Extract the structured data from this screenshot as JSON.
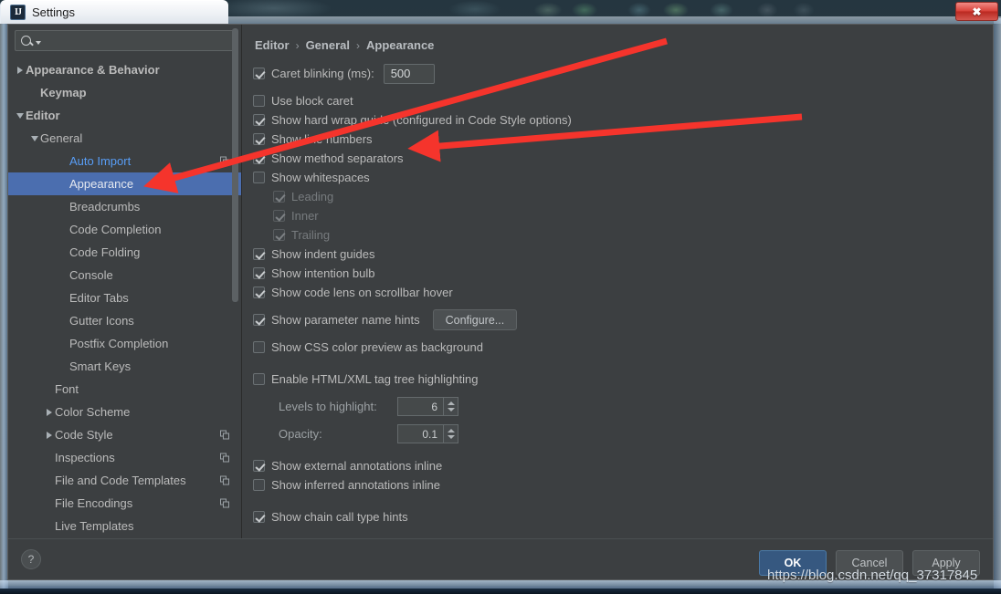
{
  "window": {
    "title": "Settings",
    "app_icon": "intellij-idea-logo",
    "close_label": "✖"
  },
  "sidebar": {
    "search": {
      "value": "",
      "placeholder": "",
      "icon": "search-icon"
    },
    "items": [
      {
        "label": "Appearance & Behavior",
        "indent": 0,
        "arrow": "right",
        "bold": true,
        "selected": false,
        "modified": false,
        "copy": false
      },
      {
        "label": "Keymap",
        "indent": 1,
        "arrow": "none",
        "bold": true,
        "selected": false,
        "modified": false,
        "copy": false
      },
      {
        "label": "Editor",
        "indent": 0,
        "arrow": "down",
        "bold": true,
        "selected": false,
        "modified": false,
        "copy": false
      },
      {
        "label": "General",
        "indent": 1,
        "arrow": "down",
        "bold": false,
        "selected": false,
        "modified": false,
        "copy": false
      },
      {
        "label": "Auto Import",
        "indent": 3,
        "arrow": "none",
        "bold": false,
        "selected": false,
        "modified": true,
        "copy": true
      },
      {
        "label": "Appearance",
        "indent": 3,
        "arrow": "none",
        "bold": false,
        "selected": true,
        "modified": false,
        "copy": false
      },
      {
        "label": "Breadcrumbs",
        "indent": 3,
        "arrow": "none",
        "bold": false,
        "selected": false,
        "modified": false,
        "copy": false
      },
      {
        "label": "Code Completion",
        "indent": 3,
        "arrow": "none",
        "bold": false,
        "selected": false,
        "modified": false,
        "copy": false
      },
      {
        "label": "Code Folding",
        "indent": 3,
        "arrow": "none",
        "bold": false,
        "selected": false,
        "modified": false,
        "copy": false
      },
      {
        "label": "Console",
        "indent": 3,
        "arrow": "none",
        "bold": false,
        "selected": false,
        "modified": false,
        "copy": false
      },
      {
        "label": "Editor Tabs",
        "indent": 3,
        "arrow": "none",
        "bold": false,
        "selected": false,
        "modified": false,
        "copy": false
      },
      {
        "label": "Gutter Icons",
        "indent": 3,
        "arrow": "none",
        "bold": false,
        "selected": false,
        "modified": false,
        "copy": false
      },
      {
        "label": "Postfix Completion",
        "indent": 3,
        "arrow": "none",
        "bold": false,
        "selected": false,
        "modified": false,
        "copy": false
      },
      {
        "label": "Smart Keys",
        "indent": 3,
        "arrow": "none",
        "bold": false,
        "selected": false,
        "modified": false,
        "copy": false
      },
      {
        "label": "Font",
        "indent": 2,
        "arrow": "none",
        "bold": false,
        "selected": false,
        "modified": false,
        "copy": false
      },
      {
        "label": "Color Scheme",
        "indent": 2,
        "arrow": "right",
        "bold": false,
        "selected": false,
        "modified": false,
        "copy": false
      },
      {
        "label": "Code Style",
        "indent": 2,
        "arrow": "right",
        "bold": false,
        "selected": false,
        "modified": false,
        "copy": true
      },
      {
        "label": "Inspections",
        "indent": 2,
        "arrow": "none",
        "bold": false,
        "selected": false,
        "modified": false,
        "copy": true
      },
      {
        "label": "File and Code Templates",
        "indent": 2,
        "arrow": "none",
        "bold": false,
        "selected": false,
        "modified": false,
        "copy": true
      },
      {
        "label": "File Encodings",
        "indent": 2,
        "arrow": "none",
        "bold": false,
        "selected": false,
        "modified": false,
        "copy": true
      },
      {
        "label": "Live Templates",
        "indent": 2,
        "arrow": "none",
        "bold": false,
        "selected": false,
        "modified": false,
        "copy": false
      }
    ]
  },
  "breadcrumb": {
    "part1": "Editor",
    "sep1": "›",
    "part2": "General",
    "sep2": "›",
    "part3": "Appearance"
  },
  "options": {
    "caret_blinking": {
      "label": "Caret blinking (ms):",
      "checked": true,
      "value": "500"
    },
    "use_block_caret": {
      "label": "Use block caret",
      "checked": false
    },
    "show_hard_wrap_guide": {
      "label": "Show hard wrap guide (configured in Code Style options)",
      "checked": true
    },
    "show_line_numbers": {
      "label": "Show line numbers",
      "checked": true
    },
    "show_method_separators": {
      "label": "Show method separators",
      "checked": true
    },
    "show_whitespaces": {
      "label": "Show whitespaces",
      "checked": false
    },
    "leading": {
      "label": "Leading",
      "checked": true,
      "disabled": true
    },
    "inner": {
      "label": "Inner",
      "checked": true,
      "disabled": true
    },
    "trailing": {
      "label": "Trailing",
      "checked": true,
      "disabled": true
    },
    "show_indent_guides": {
      "label": "Show indent guides",
      "checked": true
    },
    "show_intention_bulb": {
      "label": "Show intention bulb",
      "checked": true
    },
    "show_code_lens": {
      "label": "Show code lens on scrollbar hover",
      "checked": true
    },
    "show_parameter_name_hints": {
      "label": "Show parameter name hints",
      "checked": true,
      "button": "Configure..."
    },
    "show_css_color_preview": {
      "label": "Show CSS color preview as background",
      "checked": false
    },
    "enable_html_xml_tag_tree": {
      "label": "Enable HTML/XML tag tree highlighting",
      "checked": false
    },
    "levels_to_highlight": {
      "label": "Levels to highlight:",
      "value": "6"
    },
    "opacity": {
      "label": "Opacity:",
      "value": "0.1"
    },
    "show_external_annotations": {
      "label": "Show external annotations inline",
      "checked": true
    },
    "show_inferred_annotations": {
      "label": "Show inferred annotations inline",
      "checked": false
    },
    "show_chain_call_type_hints": {
      "label": "Show chain call type hints",
      "checked": true
    }
  },
  "footer": {
    "help_label": "?",
    "ok_label": "OK",
    "cancel_label": "Cancel",
    "apply_label": "Apply"
  },
  "watermark": "https://blog.csdn.net/qq_37317845",
  "colors": {
    "accent_selection": "#4b6eaf",
    "modified_item": "#589df6",
    "panel_bg": "#3c3f41",
    "primary_button": "#365880",
    "annotation_arrow": "#f5342c"
  }
}
